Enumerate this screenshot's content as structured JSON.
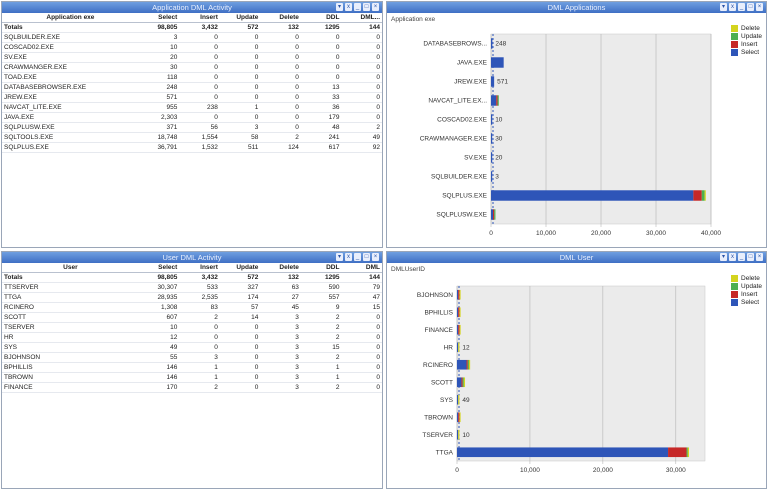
{
  "app_panel": {
    "title": "Application DML Activity",
    "headers": [
      "Application exe",
      "Select",
      "Insert",
      "Update",
      "Delete",
      "DDL",
      "DML..."
    ],
    "totals": [
      "Totals",
      "98,805",
      "3,432",
      "572",
      "132",
      "1295",
      "144"
    ],
    "rows": [
      [
        "SQLBUILDER.EXE",
        "3",
        "0",
        "0",
        "0",
        "0",
        "0"
      ],
      [
        "COSCAD02.EXE",
        "10",
        "0",
        "0",
        "0",
        "0",
        "0"
      ],
      [
        "SV.EXE",
        "20",
        "0",
        "0",
        "0",
        "0",
        "0"
      ],
      [
        "CRAWMANGER.EXE",
        "30",
        "0",
        "0",
        "0",
        "0",
        "0"
      ],
      [
        "TOAD.EXE",
        "118",
        "0",
        "0",
        "0",
        "0",
        "0"
      ],
      [
        "DATABASEBROWSER.EXE",
        "248",
        "0",
        "0",
        "0",
        "13",
        "0"
      ],
      [
        "JREW.EXE",
        "571",
        "0",
        "0",
        "0",
        "33",
        "0"
      ],
      [
        "NAVCAT_LITE.EXE",
        "955",
        "238",
        "1",
        "0",
        "36",
        "0"
      ],
      [
        "JAVA.EXE",
        "2,303",
        "0",
        "0",
        "0",
        "179",
        "0"
      ],
      [
        "SQLPLUSW.EXE",
        "371",
        "56",
        "3",
        "0",
        "48",
        "2"
      ],
      [
        "SQLTOOLS.EXE",
        "18,748",
        "1,554",
        "58",
        "2",
        "241",
        "49"
      ],
      [
        "SQLPLUS.EXE",
        "36,791",
        "1,532",
        "511",
        "124",
        "617",
        "92"
      ]
    ]
  },
  "user_panel": {
    "title": "User DML Activity",
    "headers": [
      "User",
      "Select",
      "Insert",
      "Update",
      "Delete",
      "DDL",
      "DML"
    ],
    "totals": [
      "Totals",
      "98,805",
      "3,432",
      "572",
      "132",
      "1295",
      "144"
    ],
    "rows": [
      [
        "TTSERVER",
        "30,307",
        "533",
        "327",
        "63",
        "590",
        "79"
      ],
      [
        "TTGA",
        "28,935",
        "2,535",
        "174",
        "27",
        "557",
        "47"
      ],
      [
        "RCINERO",
        "1,308",
        "83",
        "57",
        "45",
        "9",
        "15"
      ],
      [
        "SCOTT",
        "607",
        "2",
        "14",
        "3",
        "2",
        "0"
      ],
      [
        "TSERVER",
        "10",
        "0",
        "0",
        "3",
        "2",
        "0"
      ],
      [
        "HR",
        "12",
        "0",
        "0",
        "3",
        "2",
        "0"
      ],
      [
        "SYS",
        "49",
        "0",
        "0",
        "3",
        "15",
        "0"
      ],
      [
        "BJOHNSON",
        "55",
        "3",
        "0",
        "3",
        "2",
        "0"
      ],
      [
        "BPHILLIS",
        "146",
        "1",
        "0",
        "3",
        "1",
        "0"
      ],
      [
        "TBROWN",
        "146",
        "1",
        "0",
        "3",
        "1",
        "0"
      ],
      [
        "FINANCE",
        "170",
        "2",
        "0",
        "3",
        "2",
        "0"
      ]
    ]
  },
  "app_chart_panel": {
    "title": "DML Applications",
    "dim_label": "Application exe"
  },
  "user_chart_panel": {
    "title": "DML User",
    "dim_label": "DMLUserID"
  },
  "legend": [
    {
      "name": "Delete",
      "color": "#d4d41e"
    },
    {
      "name": "Update",
      "color": "#4caf50"
    },
    {
      "name": "Insert",
      "color": "#c62828"
    },
    {
      "name": "Select",
      "color": "#2e55b8"
    }
  ],
  "title_icons": [
    "filter-icon",
    "xl-icon",
    "minimize-icon",
    "maximize-icon",
    "close-icon"
  ],
  "chart_data": [
    {
      "type": "bar",
      "orientation": "horizontal",
      "stacked": true,
      "categories": [
        "DATABASEBROWS...",
        "JAVA.EXE",
        "JREW.EXE",
        "NAVCAT_LITE.EX...",
        "COSCAD02.EXE",
        "CRAWMANAGER.EXE",
        "SV.EXE",
        "SQLBUILDER.EXE",
        "SQLPLUS.EXE",
        "SQLPLUSW.EXE"
      ],
      "data_labels": [
        "248",
        "",
        "571",
        "",
        "10",
        "30",
        "20",
        "3",
        "",
        ""
      ],
      "series": [
        {
          "name": "Select",
          "values": [
            248,
            2303,
            571,
            955,
            10,
            30,
            20,
            3,
            36791,
            371
          ]
        },
        {
          "name": "Insert",
          "values": [
            0,
            0,
            0,
            238,
            0,
            0,
            0,
            0,
            1532,
            56
          ]
        },
        {
          "name": "Update",
          "values": [
            0,
            0,
            0,
            1,
            0,
            0,
            0,
            0,
            511,
            3
          ]
        },
        {
          "name": "Delete",
          "values": [
            0,
            0,
            0,
            0,
            0,
            0,
            0,
            0,
            124,
            0
          ]
        }
      ],
      "xticks": [
        "0",
        "10,000",
        "20,000",
        "30,000",
        "40,000"
      ],
      "xlim": [
        0,
        40000
      ]
    },
    {
      "type": "bar",
      "orientation": "horizontal",
      "stacked": true,
      "categories": [
        "BJOHNSON",
        "BPHILLIS",
        "FINANCE",
        "HR",
        "RCINERO",
        "SCOTT",
        "SYS",
        "TBROWN",
        "TSERVER",
        "TTGA"
      ],
      "data_labels": [
        "",
        "",
        "",
        "12",
        "",
        "",
        "49",
        "",
        "10",
        ""
      ],
      "series": [
        {
          "name": "Select",
          "values": [
            55,
            146,
            170,
            12,
            1308,
            607,
            49,
            146,
            10,
            28935
          ]
        },
        {
          "name": "Insert",
          "values": [
            3,
            1,
            2,
            0,
            83,
            2,
            0,
            1,
            0,
            2535
          ]
        },
        {
          "name": "Update",
          "values": [
            0,
            0,
            0,
            0,
            57,
            14,
            0,
            0,
            0,
            174
          ]
        },
        {
          "name": "Delete",
          "values": [
            3,
            3,
            3,
            3,
            45,
            3,
            3,
            3,
            3,
            27
          ]
        }
      ],
      "xticks": [
        "0",
        "10,000",
        "20,000",
        "30,000"
      ],
      "xlim": [
        0,
        34000
      ]
    }
  ]
}
